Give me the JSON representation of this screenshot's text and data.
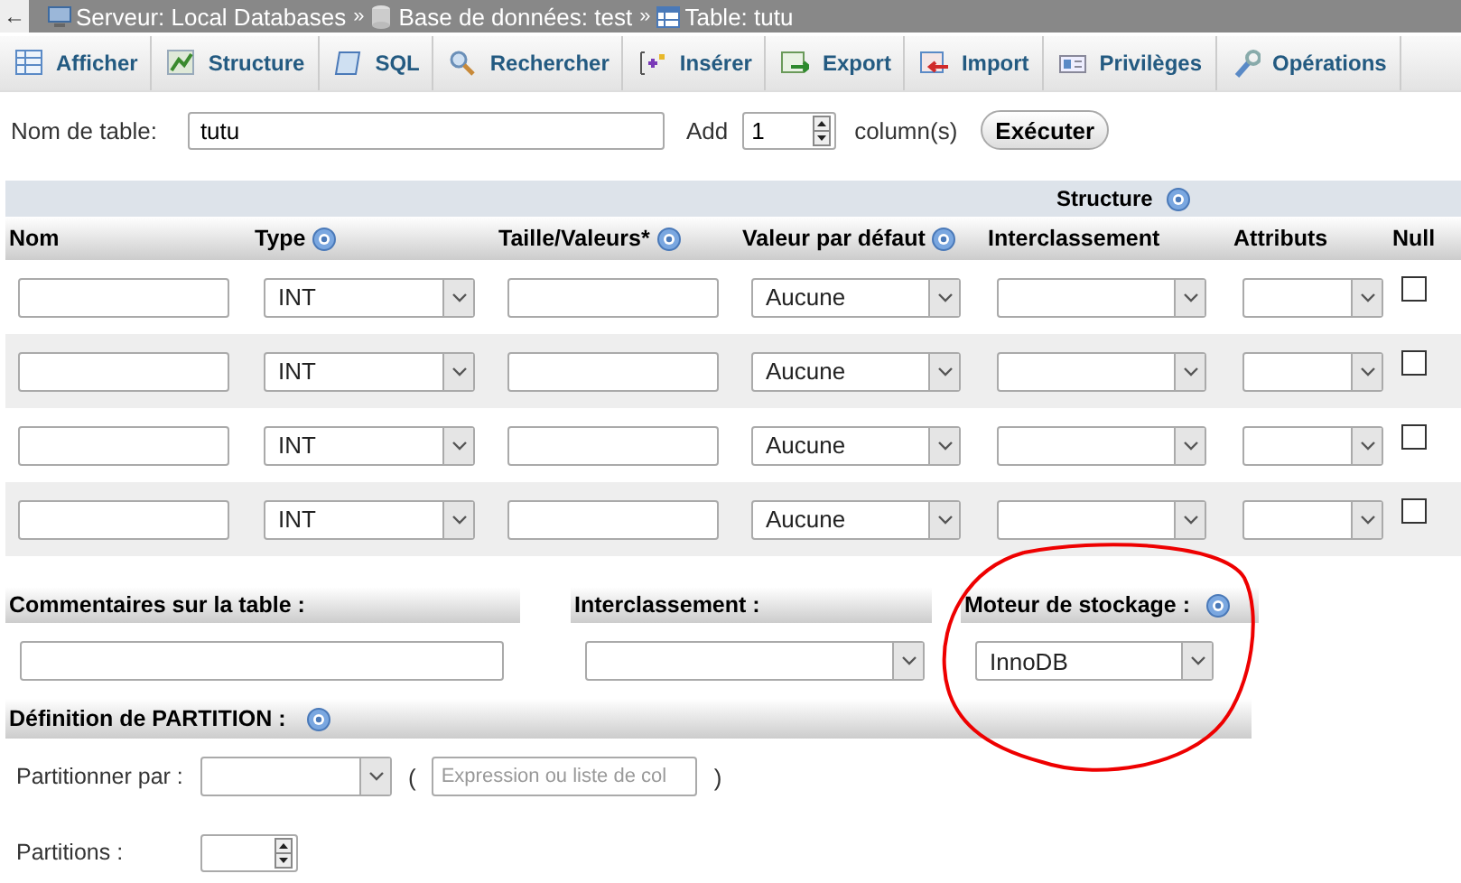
{
  "breadcrumb": {
    "back": "←",
    "items": [
      {
        "kind": "server",
        "label": "Serveur: Local Databases",
        "separator": "»"
      },
      {
        "kind": "database",
        "label": "Base de données: test",
        "separator": "»"
      },
      {
        "kind": "table",
        "label": "Table: tutu"
      }
    ]
  },
  "tabs": [
    {
      "label": "Afficher",
      "selected": false
    },
    {
      "label": "Structure",
      "selected": false
    },
    {
      "label": "SQL",
      "selected": false
    },
    {
      "label": "Rechercher",
      "selected": false
    },
    {
      "label": "Insérer",
      "selected": false
    },
    {
      "label": "Export",
      "selected": false
    },
    {
      "label": "Import",
      "selected": false
    },
    {
      "label": "Privilèges",
      "selected": false
    },
    {
      "label": "Opérations",
      "selected": false
    }
  ],
  "table_name": {
    "label": "Nom de table:",
    "value": "tutu",
    "add_label": "Add",
    "add_value": "1",
    "add_suffix": "column(s)",
    "button": "Exécuter"
  },
  "structure": {
    "title": "Structure",
    "title_help": true,
    "columns": [
      {
        "label": "Nom",
        "help": false
      },
      {
        "label": "Type",
        "help": true
      },
      {
        "label": "Taille/Valeurs*",
        "help": true
      },
      {
        "label": "Valeur par défaut",
        "help": true
      },
      {
        "label": "Interclassement",
        "help": false
      },
      {
        "label": "Attributs",
        "help": false
      },
      {
        "label": "Null",
        "help": false
      }
    ],
    "rows": [
      {
        "type": "INT",
        "default": "Aucune",
        "null": false
      },
      {
        "type": "INT",
        "default": "Aucune",
        "null": false
      },
      {
        "type": "INT",
        "default": "Aucune",
        "null": false
      },
      {
        "type": "INT",
        "default": "Aucune",
        "null": false
      }
    ]
  },
  "options": {
    "comments": {
      "header": "Commentaires sur la table :"
    },
    "collation": {
      "header": "Interclassement :"
    },
    "storage_engine": {
      "header": "Moteur de stockage :",
      "help": true,
      "value": "InnoDB",
      "highlighted": true
    }
  },
  "partition": {
    "header": "Définition de PARTITION :",
    "help": true,
    "partition_by": {
      "label": "Partitionner par :",
      "open_paren": "(",
      "placeholder": "Expression ou liste de col",
      "close_paren": ")"
    },
    "partitions": {
      "label": "Partitions :"
    }
  }
}
